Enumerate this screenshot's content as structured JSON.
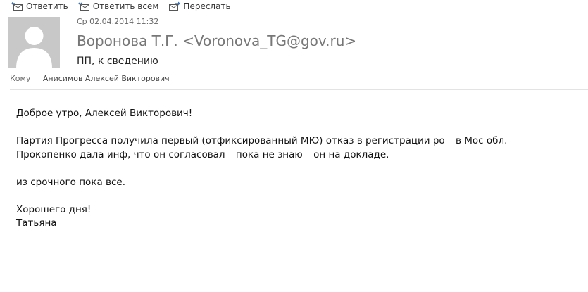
{
  "toolbar": {
    "reply_label": "Ответить",
    "reply_all_label": "Ответить всем",
    "forward_label": "Переслать"
  },
  "header": {
    "date": "Ср 02.04.2014 11:32",
    "sender": "Воронова Т.Г. <Voronova_TG@gov.ru>",
    "subject": "ПП, к сведению",
    "to_label": "Кому",
    "to_name": "Анисимов Алексей Викторович"
  },
  "body": {
    "greeting": "Доброе утро, Алексей Викторович!",
    "line1": "Партия Прогресса получила первый (отфиксированный МЮ) отказ в регистрации ро – в Мос обл.",
    "line2": "Прокопенко дала инф, что он согласовал – пока не знаю – он на докладе.",
    "line3": "из срочного пока все.",
    "closing": "Хорошего дня!",
    "signature": "Татьяна"
  }
}
